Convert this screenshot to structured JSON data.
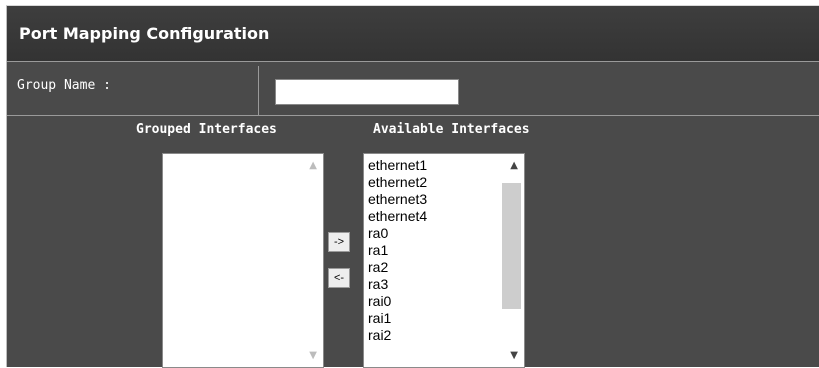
{
  "header": {
    "title": "Port Mapping Configuration"
  },
  "group_name": {
    "label": "Group Name :",
    "value": "",
    "placeholder": ""
  },
  "grouped": {
    "label": "Grouped Interfaces",
    "items": []
  },
  "available": {
    "label": "Available Interfaces",
    "items": [
      "ethernet1",
      "ethernet2",
      "ethernet3",
      "ethernet4",
      "ra0",
      "ra1",
      "ra2",
      "ra3",
      "rai0",
      "rai1",
      "rai2"
    ]
  },
  "buttons": {
    "move_right": "->",
    "move_left": "<-"
  },
  "icons": {
    "scroll_up": "chevron-up-icon",
    "scroll_down": "chevron-down-icon"
  },
  "colors": {
    "panel": "#4a4a4a",
    "header": "#3a3a3a",
    "text": "#ffffff"
  }
}
